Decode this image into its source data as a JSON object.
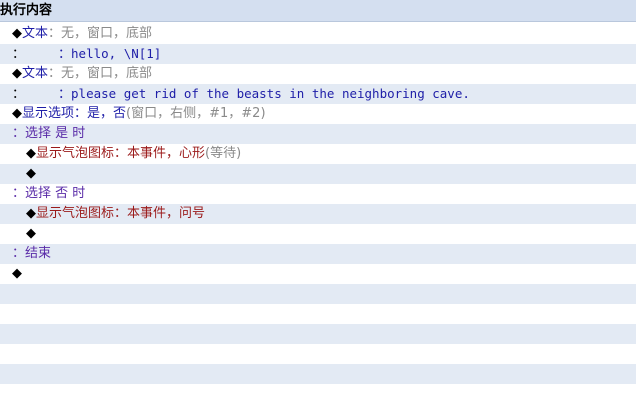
{
  "header": {
    "title": "执行内容"
  },
  "rows": {
    "r0": {
      "marker": "◆",
      "cmd": "文本",
      "sep": "：",
      "args": "无，窗口，底部"
    },
    "r1": {
      "lead": "：",
      "sep": "：",
      "text": "hello, \\N[1]"
    },
    "r2": {
      "marker": "◆",
      "cmd": "文本",
      "sep": "：",
      "args": "无，窗口，底部"
    },
    "r3": {
      "lead": "：",
      "sep": "：",
      "text": "please get rid of the beasts in the neighboring cave."
    },
    "r4": {
      "marker": "◆",
      "cmd": "显示选项",
      "sep": "：",
      "main": "是，否",
      "args": "(窗口，右侧，#1，#2)"
    },
    "r5": {
      "lead": "：",
      "label": "选择 是 时"
    },
    "r6": {
      "marker": "◆",
      "cmd": "显示气泡图标",
      "sep": "：",
      "main": "本事件，心形",
      "args": "(等待)"
    },
    "r7": {
      "marker": "◆"
    },
    "r8": {
      "lead": "：",
      "label": "选择 否 时"
    },
    "r9": {
      "marker": "◆",
      "cmd": "显示气泡图标",
      "sep": "：",
      "main": "本事件，问号"
    },
    "r10": {
      "marker": "◆"
    },
    "r11": {
      "lead": "：",
      "label": "结束"
    },
    "r12": {
      "marker": "◆"
    }
  },
  "colors": {
    "header_bg": "#d4dff0",
    "row_alt": "#e3eaf4",
    "text_command": "#1e1ea8",
    "branch": "#5a2ca8",
    "bubble": "#9b1a1a",
    "args_gray": "#8a8a8a"
  }
}
